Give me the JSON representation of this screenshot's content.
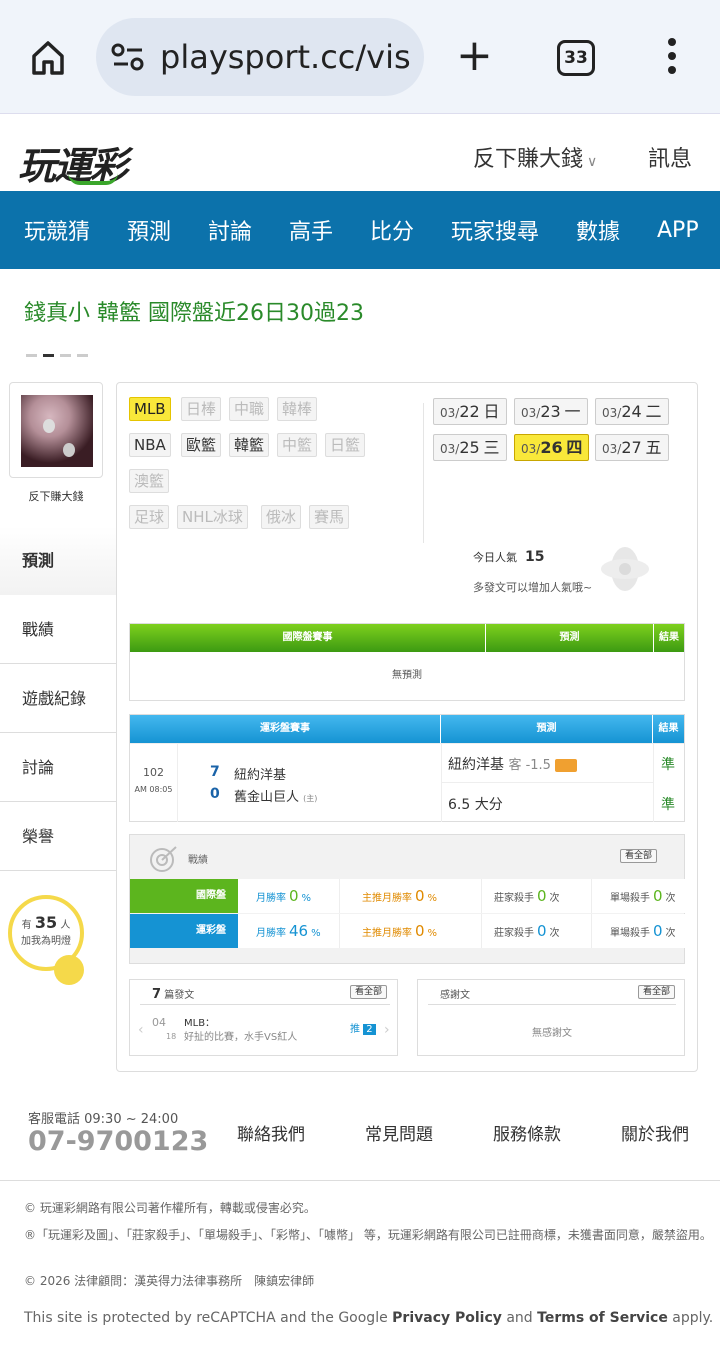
{
  "browser": {
    "url": "playsport.cc/vis",
    "tab_count": "33"
  },
  "header": {
    "logo": "玩運彩",
    "user": "反下賺大錢",
    "messages": "訊息"
  },
  "nav": [
    "玩競猜",
    "預測",
    "討論",
    "高手",
    "比分",
    "玩家搜尋",
    "數據",
    "APP"
  ],
  "ticker": "錢真小 韓籃 國際盤近26日30過23",
  "sidebar": {
    "username": "反下賺大錢",
    "menu": [
      "預測",
      "戰績",
      "遊戲紀錄",
      "討論",
      "榮譽"
    ],
    "fans_prefix": "有",
    "fans_count": "35",
    "fans_suffix": "人",
    "fans_action": "加我為明燈"
  },
  "leagues": [
    "MLB",
    "日棒",
    "中職",
    "韓棒",
    "NBA",
    "歐籃",
    "韓籃",
    "中籃",
    "日籃",
    "澳籃",
    "足球",
    "NHL冰球",
    "俄冰",
    "賽馬"
  ],
  "dates": [
    {
      "md": "03/",
      "d": "22",
      "w": "日"
    },
    {
      "md": "03/",
      "d": "23",
      "w": "一"
    },
    {
      "md": "03/",
      "d": "24",
      "w": "二"
    },
    {
      "md": "03/",
      "d": "25",
      "w": "三"
    },
    {
      "md": "03/",
      "d": "26",
      "w": "四"
    },
    {
      "md": "03/",
      "d": "27",
      "w": "五"
    }
  ],
  "popularity": {
    "label": "今日人氣",
    "value": "15",
    "hint": "多發文可以增加人氣哦~"
  },
  "intl_table": {
    "h1": "國際盤賽事",
    "h2": "預測",
    "h3": "結果",
    "empty": "無預測"
  },
  "sport_table": {
    "h1": "運彩盤賽事",
    "h2": "預測",
    "h3": "結果",
    "game_no": "102",
    "time": "AM 08:05",
    "away_score": "7",
    "away": "紐約洋基",
    "home_score": "0",
    "home": "舊金山巨人",
    "home_tag": "(主)",
    "pick1": "紐約洋基",
    "pick1_line": "客 -1.5",
    "pick1_badge": "",
    "pick2": "6.5 大分",
    "res1": "準",
    "res2": "準"
  },
  "record": {
    "title": "戰績",
    "all": "看全部",
    "rows": [
      {
        "label": "國際盤",
        "m_label": "月勝率",
        "m_val": "0",
        "p_label": "主推月勝率",
        "p_val": "0",
        "z_label": "莊家殺手",
        "z_val": "0",
        "z_unit": "次",
        "s_label": "單場殺手",
        "s_val": "0",
        "s_unit": "次",
        "pct": "%"
      },
      {
        "label": "運彩盤",
        "m_label": "月勝率",
        "m_val": "46",
        "p_label": "主推月勝率",
        "p_val": "0",
        "z_label": "莊家殺手",
        "z_val": "0",
        "z_unit": "次",
        "s_label": "單場殺手",
        "s_val": "0",
        "s_unit": "次",
        "pct": "%"
      }
    ]
  },
  "posts": {
    "count": "7",
    "label": "篇發文",
    "all": "看全部",
    "month": "04",
    "day": "18",
    "title": "MLB：",
    "desc": "好扯的比賽，水手VS紅人",
    "push": "推",
    "push_n": "2"
  },
  "thanks": {
    "label": "感謝文",
    "all": "看全部",
    "empty": "無感謝文"
  },
  "footer": {
    "hours": "客服電話 09:30 ~ 24:00",
    "phone": "07-9700123",
    "links": [
      "聯絡我們",
      "常見問題",
      "服務條款",
      "關於我們"
    ],
    "copyright": "© 玩運彩網路有限公司著作權所有，轉載或侵害必究。",
    "trademark": "®「玩運彩及圖」、「莊家殺手」、「單場殺手」、「彩幣」、「噱幣」 等，玩運彩網路有限公司已註冊商標，未獲書面同意，嚴禁盜用。",
    "legal": "© 2026 法律顧問：漢英得力法律事務所　陳鎮宏律師",
    "recaptcha_pre": "This site is protected by reCAPTCHA and the Google ",
    "privacy": "Privacy Policy",
    "and": " and ",
    "tos": "Terms of Service",
    "apply": " apply."
  },
  "colors": {
    "nav": "#0c72ab",
    "green": "#3c9a12",
    "blue": "#1593d3",
    "yellow": "#f9e83a"
  }
}
